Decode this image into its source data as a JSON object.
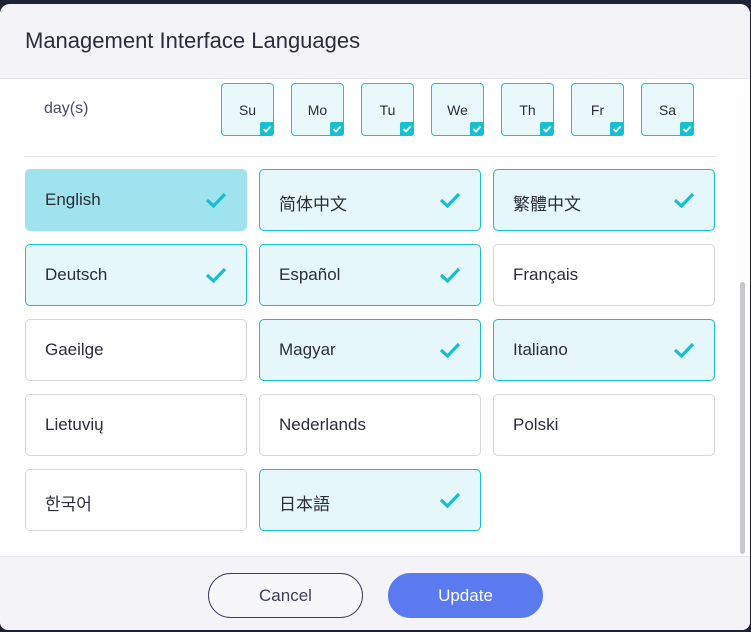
{
  "dialog": {
    "title": "Management Interface Languages"
  },
  "schedule": {
    "days_label": "day(s)",
    "days": [
      {
        "label": "Su",
        "checked": true
      },
      {
        "label": "Mo",
        "checked": true
      },
      {
        "label": "Tu",
        "checked": true
      },
      {
        "label": "We",
        "checked": true
      },
      {
        "label": "Th",
        "checked": true
      },
      {
        "label": "Fr",
        "checked": true
      },
      {
        "label": "Sa",
        "checked": true
      }
    ]
  },
  "languages": [
    {
      "label": "English",
      "selected": true,
      "state": "primary"
    },
    {
      "label": "简体中文",
      "selected": true
    },
    {
      "label": "繁體中文",
      "selected": true
    },
    {
      "label": "Deutsch",
      "selected": true
    },
    {
      "label": "Español",
      "selected": true
    },
    {
      "label": "Français",
      "selected": false
    },
    {
      "label": "Gaeilge",
      "selected": false
    },
    {
      "label": "Magyar",
      "selected": true
    },
    {
      "label": "Italiano",
      "selected": true
    },
    {
      "label": "Lietuvių",
      "selected": false
    },
    {
      "label": "Nederlands",
      "selected": false
    },
    {
      "label": "Polski",
      "selected": false
    },
    {
      "label": "한국어",
      "selected": false
    },
    {
      "label": "日本語",
      "selected": true
    }
  ],
  "footer": {
    "cancel_label": "Cancel",
    "update_label": "Update"
  },
  "colors": {
    "accent": "#18bfd0",
    "selected_bg": "#e5f7fb",
    "primary_bg": "#9fe3ee",
    "update_button": "#5a7af0"
  },
  "icons": {
    "check": "check-icon"
  }
}
